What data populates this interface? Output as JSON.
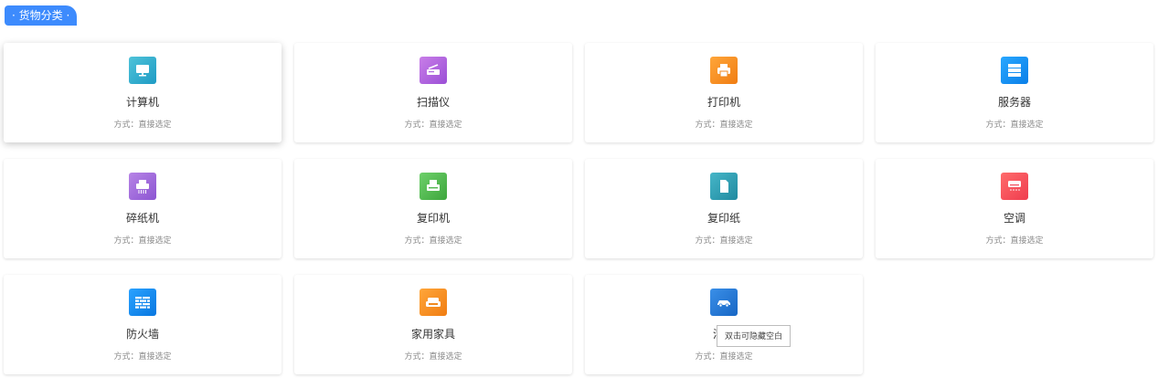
{
  "header": {
    "title": "· 货物分类 ·"
  },
  "method_label": "方式：",
  "method_value": "直接选定",
  "tooltip": "双击可隐藏空白",
  "categories": [
    {
      "label": "计算机",
      "icon": "monitor-icon",
      "color_start": "#4fc3d9",
      "color_end": "#1e9bc4"
    },
    {
      "label": "扫描仪",
      "icon": "scanner-icon",
      "color_start": "#c87ee8",
      "color_end": "#9b4fd6"
    },
    {
      "label": "打印机",
      "icon": "printer-icon",
      "color_start": "#ffa63a",
      "color_end": "#f07d12"
    },
    {
      "label": "服务器",
      "icon": "server-icon",
      "color_start": "#29a7ff",
      "color_end": "#0a7fe8"
    },
    {
      "label": "碎纸机",
      "icon": "shredder-icon",
      "color_start": "#b784e6",
      "color_end": "#8c55d2"
    },
    {
      "label": "复印机",
      "icon": "copier-icon",
      "color_start": "#6dd06a",
      "color_end": "#3ea63d"
    },
    {
      "label": "复印纸",
      "icon": "paper-icon",
      "color_start": "#46b6c8",
      "color_end": "#1f8aa0"
    },
    {
      "label": "空调",
      "icon": "air-conditioner-icon",
      "color_start": "#ff6b6b",
      "color_end": "#ef3d4f"
    },
    {
      "label": "防火墙",
      "icon": "firewall-icon",
      "color_start": "#2aa2ff",
      "color_end": "#0877e0"
    },
    {
      "label": "家用家具",
      "icon": "sofa-icon",
      "color_start": "#ffa63a",
      "color_end": "#f07d12"
    },
    {
      "label": "汽车",
      "icon": "car-icon",
      "color_start": "#3a8fe8",
      "color_end": "#1766c4"
    }
  ]
}
